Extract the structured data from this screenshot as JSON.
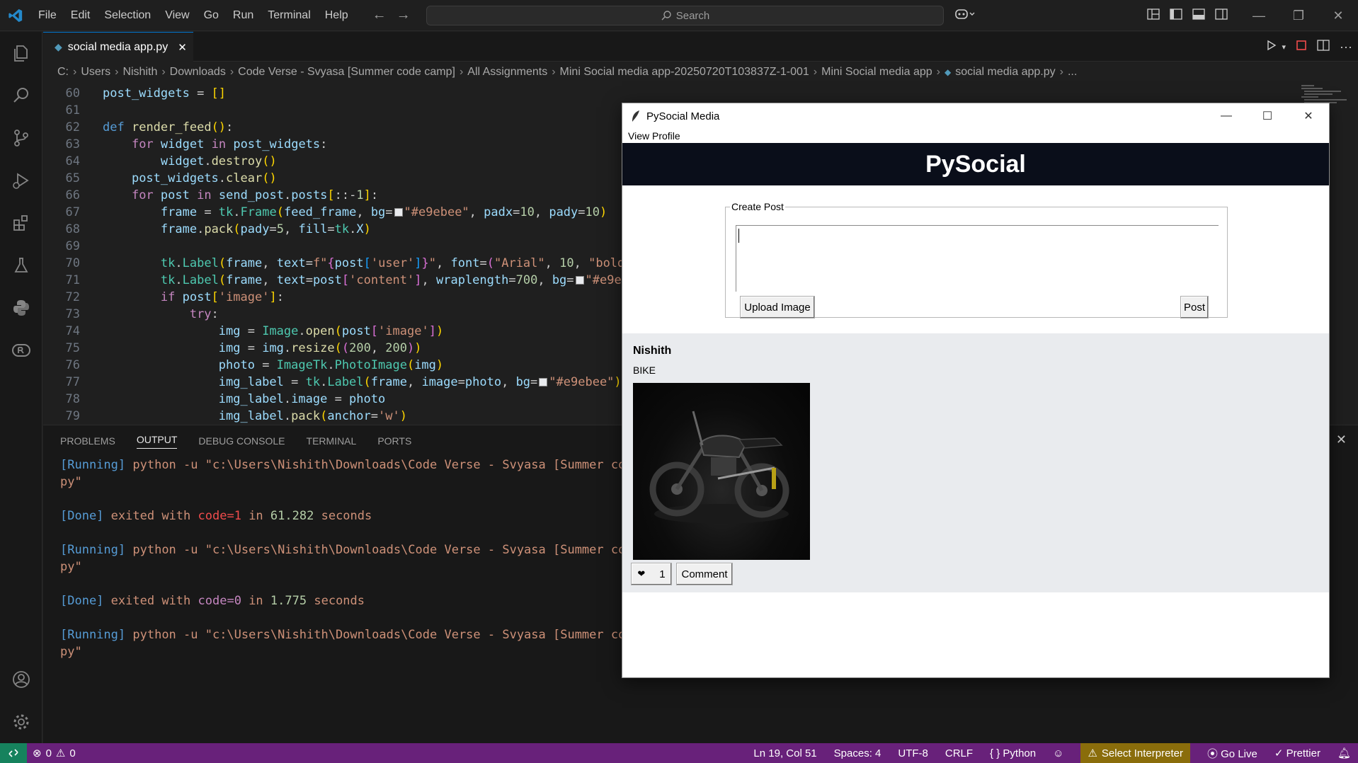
{
  "menu": [
    "File",
    "Edit",
    "Selection",
    "View",
    "Go",
    "Run",
    "Terminal",
    "Help"
  ],
  "search": {
    "placeholder": "Search"
  },
  "tab": {
    "label": "social media app.py"
  },
  "breadcrumb": [
    "C:",
    "Users",
    "Nishith",
    "Downloads",
    "Code Verse - Svyasa [Summer code camp]",
    "All Assignments",
    "Mini Social media app-20250720T103837Z-1-001",
    "Mini Social media app",
    "social media app.py",
    "..."
  ],
  "editor": {
    "line_numbers": [
      "60",
      "61",
      "62",
      "63",
      "64",
      "65",
      "66",
      "67",
      "68",
      "69",
      "70",
      "71",
      "72",
      "73",
      "74",
      "75",
      "76",
      "77",
      "78",
      "79"
    ]
  },
  "panel": {
    "tabs": [
      "PROBLEMS",
      "OUTPUT",
      "DEBUG CONSOLE",
      "TERMINAL",
      "PORTS"
    ],
    "active_tab": "OUTPUT",
    "output": {
      "running_tag": "[Running]",
      "running_cmd": "python -u \"c:\\Users\\Nishith\\Downloads\\Code Verse - Svyasa [Summer code ca",
      "running_cont": "py\"",
      "done_tag": "[Done]",
      "exited_with": "exited with",
      "code1": "code=1",
      "in": "in",
      "time1": "61.282",
      "code0": "code=0",
      "time2": "1.775",
      "seconds": "seconds"
    }
  },
  "statusbar": {
    "errors": "0",
    "warnings": "0",
    "position": "Ln 19, Col 51",
    "spaces": "Spaces: 4",
    "encoding": "UTF-8",
    "eol": "CRLF",
    "language": "Python",
    "interpreter": "Select Interpreter",
    "golive": "Go Live",
    "prettier": "Prettier"
  },
  "tk": {
    "title": "PySocial Media",
    "menu": "View Profile",
    "header": "PySocial",
    "create_post_label": "Create Post",
    "upload_button": "Upload Image",
    "post_button": "Post",
    "post": {
      "user": "Nishith",
      "content": "BIKE",
      "likes": "1",
      "comment_button": "Comment"
    }
  },
  "colors": {
    "statusbar": "#68217a",
    "accent": "#0078d4",
    "tk_header": "#0a0e1a",
    "feed_bg": "#e9ebee"
  }
}
